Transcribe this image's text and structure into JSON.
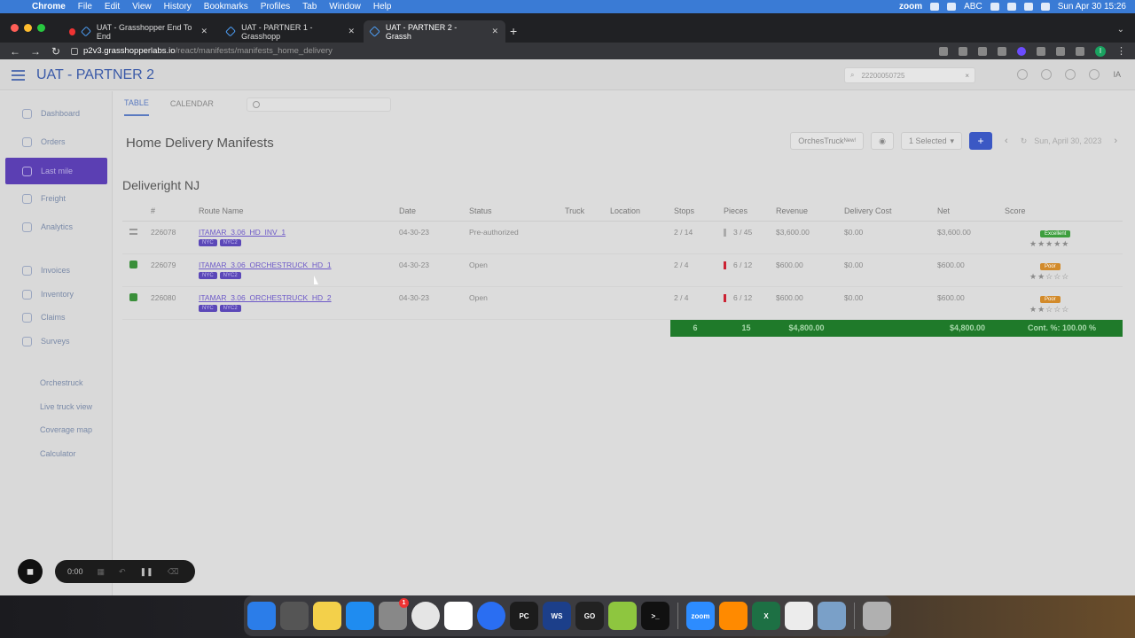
{
  "menubar": {
    "app": "Chrome",
    "items": [
      "File",
      "Edit",
      "View",
      "History",
      "Bookmarks",
      "Profiles",
      "Tab",
      "Window",
      "Help"
    ],
    "zoom_label": "zoom",
    "abc_label": "ABC",
    "datetime": "Sun Apr 30  15:26"
  },
  "tabs": [
    {
      "title": "UAT - Grasshopper End To End"
    },
    {
      "title": "UAT - PARTNER 1 - Grasshopp"
    },
    {
      "title": "UAT - PARTNER 2 - Grassh"
    }
  ],
  "address": {
    "host": "p2v3.grasshopperlabs.io",
    "path": "/react/manifests/manifests_home_delivery"
  },
  "app": {
    "title": "UAT - PARTNER 2",
    "search_value": "22200050725",
    "user_initials": "IA"
  },
  "sidebar": {
    "items": [
      {
        "label": "Dashboard"
      },
      {
        "label": "Orders"
      },
      {
        "label": "Last mile"
      },
      {
        "label": "Freight"
      },
      {
        "label": "Analytics"
      },
      {
        "label": "Invoices"
      },
      {
        "label": "Inventory"
      },
      {
        "label": "Claims"
      },
      {
        "label": "Surveys"
      },
      {
        "label": "Orchestruck"
      },
      {
        "label": "Live truck view"
      },
      {
        "label": "Coverage map"
      },
      {
        "label": "Calculator"
      }
    ]
  },
  "subtabs": {
    "table": "TABLE",
    "calendar": "CALENDAR"
  },
  "page": {
    "title": "Home Delivery Manifests",
    "orchestruck_label": "OrchesTruck",
    "orchestruck_badge": "New!",
    "selected_label": "1 Selected",
    "add_label": "+",
    "date": "Sun, April 30, 2023"
  },
  "group": {
    "name": "Deliveright NJ"
  },
  "table": {
    "headers": [
      "#",
      "Route Name",
      "Date",
      "Status",
      "Truck",
      "Location",
      "Stops",
      "Pieces",
      "Revenue",
      "Delivery Cost",
      "Net",
      "Score"
    ],
    "rows": [
      {
        "id": "226078",
        "route": "ITAMAR_3.06_HD_INV_1",
        "tag1": "NYC",
        "tag2": "NYC2",
        "date": "04-30-23",
        "status": "Pre-authorized",
        "truck": "",
        "location": "",
        "stops": "2 / 14",
        "pieces": "3 / 45",
        "revenue": "$3,600.00",
        "cost": "$0.00",
        "net": "$3,600.00",
        "score_badge": "Excellent",
        "stars": "★★★★★"
      },
      {
        "id": "226079",
        "route": "ITAMAR_3.06_ORCHESTRUCK_HD_1",
        "tag1": "NYC",
        "tag2": "NYC2",
        "date": "04-30-23",
        "status": "Open",
        "truck": "",
        "location": "",
        "stops": "2 / 4",
        "pieces": "6 / 12",
        "revenue": "$600.00",
        "cost": "$0.00",
        "net": "$600.00",
        "score_badge": "Poor",
        "stars": "★★☆☆☆"
      },
      {
        "id": "226080",
        "route": "ITAMAR_3.06_ORCHESTRUCK_HD_2",
        "tag1": "NYC",
        "tag2": "NYC2",
        "date": "04-30-23",
        "status": "Open",
        "truck": "",
        "location": "",
        "stops": "2 / 4",
        "pieces": "6 / 12",
        "revenue": "$600.00",
        "cost": "$0.00",
        "net": "$600.00",
        "score_badge": "Poor",
        "stars": "★★☆☆☆"
      }
    ],
    "totals": {
      "stops": "6",
      "pieces": "15",
      "revenue": "$4,800.00",
      "net": "$4,800.00",
      "score": "Cont. %: 100.00 %"
    }
  },
  "recorder": {
    "time": "0:00"
  },
  "dock": {
    "apps": [
      "finder-icon",
      "launchpad-icon",
      "notes-icon",
      "app-store-icon",
      "system-settings-icon",
      "chrome-icon",
      "slack-icon",
      "maps-icon",
      "pycharm-icon",
      "webstorm-icon",
      "goland-icon",
      "app-icon",
      "terminal-icon",
      "zoom-icon",
      "sublime-icon",
      "excel-icon",
      "numbers-icon",
      "preview-icon",
      "trash-icon"
    ],
    "labels": {
      "pycharm": "PC",
      "webstorm": "WS",
      "goland": "GO",
      "zoom": "zoom",
      "excel": "X",
      "terminal": ">_"
    },
    "settings_badge": "1"
  },
  "colors": {
    "accent": "#3b58c4",
    "sidebar_active": "#5b3fb3",
    "totals_green": "#1f7a2a"
  }
}
